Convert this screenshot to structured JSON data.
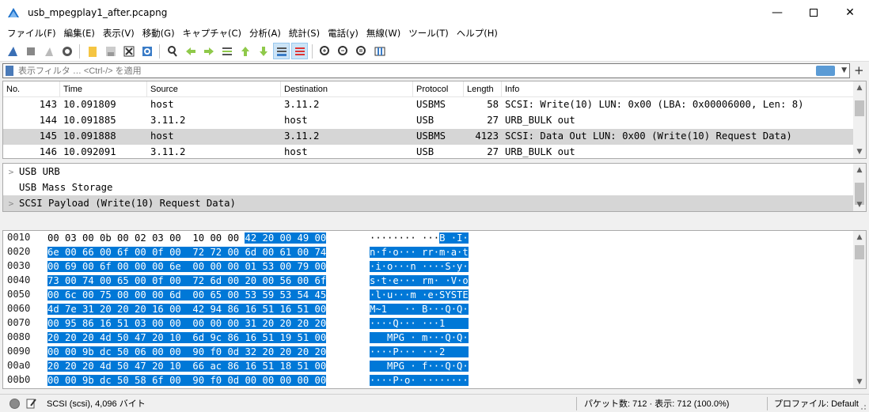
{
  "window": {
    "title": "usb_mpegplay1_after.pcapng"
  },
  "menu": [
    "ファイル(F)",
    "編集(E)",
    "表示(V)",
    "移動(G)",
    "キャプチャ(C)",
    "分析(A)",
    "統計(S)",
    "電話(y)",
    "無線(W)",
    "ツール(T)",
    "ヘルプ(H)"
  ],
  "filter": {
    "placeholder": "表示フィルタ … <Ctrl-/> を適用",
    "value": ""
  },
  "packet_list": {
    "columns": [
      "No.",
      "Time",
      "Source",
      "Destination",
      "Protocol",
      "Length",
      "Info"
    ],
    "rows": [
      {
        "no": "143",
        "time": "10.091809",
        "src": "host",
        "dst": "3.11.2",
        "proto": "USBMS",
        "len": "58",
        "info": "SCSI: Write(10) LUN: 0x00 (LBA: 0x00006000, Len: 8)"
      },
      {
        "no": "144",
        "time": "10.091885",
        "src": "3.11.2",
        "dst": "host",
        "proto": "USB",
        "len": "27",
        "info": "URB_BULK out"
      },
      {
        "no": "145",
        "time": "10.091888",
        "src": "host",
        "dst": "3.11.2",
        "proto": "USBMS",
        "len": "4123",
        "info": "SCSI: Data Out LUN: 0x00 (Write(10) Request Data)"
      },
      {
        "no": "146",
        "time": "10.092091",
        "src": "3.11.2",
        "dst": "host",
        "proto": "USB",
        "len": "27",
        "info": "URB_BULK out"
      }
    ]
  },
  "details": [
    {
      "label": "USB URB",
      "expandable": true
    },
    {
      "label": "USB Mass Storage",
      "expandable": false
    },
    {
      "label": "SCSI Payload (Write(10) Request Data)",
      "expandable": true
    }
  ],
  "bytes": [
    {
      "off": "0010",
      "hex_a": "00 03 00 0b 00 02 03 00  10 00 00 ",
      "hex_b": "42 20 00 49 00",
      "ascii_a": "········ ···",
      "ascii_b": "B ·I·"
    },
    {
      "off": "0020",
      "hex_a": "",
      "hex_b": "6e 00 66 00 6f 00 0f 00  72 72 00 6d 00 61 00 74",
      "ascii_a": "",
      "ascii_b": "n·f·o··· rr·m·a·t"
    },
    {
      "off": "0030",
      "hex_a": "",
      "hex_b": "00 69 00 6f 00 00 00 6e  00 00 00 01 53 00 79 00",
      "ascii_a": "",
      "ascii_b": "·i·o···n ····S·y·"
    },
    {
      "off": "0040",
      "hex_a": "",
      "hex_b": "73 00 74 00 65 00 0f 00  72 6d 00 20 00 56 00 6f",
      "ascii_a": "",
      "ascii_b": "s·t·e··· rm· ·V·o"
    },
    {
      "off": "0050",
      "hex_a": "",
      "hex_b": "00 6c 00 75 00 00 00 6d  00 65 00 53 59 53 54 45",
      "ascii_a": "",
      "ascii_b": "·l·u···m ·e·SYSTE"
    },
    {
      "off": "0060",
      "hex_a": "",
      "hex_b": "4d 7e 31 20 20 20 16 00  42 94 86 16 51 16 51 00",
      "ascii_a": "",
      "ascii_b": "M~1   ·· B···Q·Q·"
    },
    {
      "off": "0070",
      "hex_a": "",
      "hex_b": "00 95 86 16 51 03 00 00  00 00 00 31 20 20 20 20",
      "ascii_a": "",
      "ascii_b": "····Q··· ···1    "
    },
    {
      "off": "0080",
      "hex_a": "",
      "hex_b": "20 20 20 4d 50 47 20 10  6d 9c 86 16 51 19 51 00",
      "ascii_a": "",
      "ascii_b": "   MPG · m···Q·Q·"
    },
    {
      "off": "0090",
      "hex_a": "",
      "hex_b": "00 00 9b dc 50 06 00 00  90 f0 0d 32 20 20 20 20",
      "ascii_a": "",
      "ascii_b": "····P··· ···2    "
    },
    {
      "off": "00a0",
      "hex_a": "",
      "hex_b": "20 20 20 4d 50 47 20 10  66 ac 86 16 51 18 51 00",
      "ascii_a": "",
      "ascii_b": "   MPG · f···Q·Q·"
    },
    {
      "off": "00b0",
      "hex_a": "",
      "hex_b": "00 00 9b dc 50 58 6f 00  90 f0 0d 00 00 00 00 00",
      "ascii_a": "",
      "ascii_b": "····P·o· ········"
    }
  ],
  "status": {
    "field": "SCSI (scsi), 4,096 バイト",
    "packets": "パケット数: 712 · 表示: 712 (100.0%)",
    "profile": "プロファイル: Default"
  },
  "colors": {
    "selection": "#0078d7",
    "row_selected": "#d6d6d6"
  }
}
